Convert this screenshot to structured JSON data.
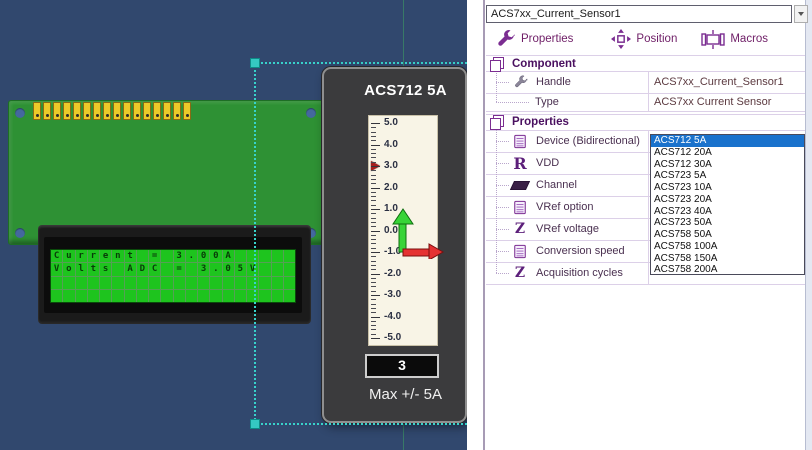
{
  "colors": {
    "canvas-bg": "#31486e",
    "grid-line": "#3a8266",
    "selection": "#38d2cb",
    "pcb": "#2e9134",
    "pin-gold": "#ecc929",
    "hole-blue": "#44689e",
    "lcd-green": "#1ec41e",
    "lcd-grid": "#55a055",
    "lcd-char": "#083c08",
    "panel-bg": "#3b3b3d",
    "scale-bg": "#f8f4e6",
    "marker-red": "#a51d1d",
    "arrow-green": "#38d438",
    "arrow-red": "#e53232",
    "accent-purple": "#7b2d91",
    "header-purple": "#4a1060",
    "label-purple": "#4a3050",
    "value-maroon": "#5c3a40",
    "list-selected": "#1a72cc"
  },
  "canvas": {
    "lcd": {
      "columns": 20,
      "rows": [
        "Current = 3.00A",
        "Volts ADC = 3.05V",
        "",
        ""
      ]
    },
    "gauge": {
      "title": "ACS712 5A",
      "value": "3",
      "max_label": "Max +/- 5A",
      "scale": {
        "min": -5,
        "max": 5,
        "minor_step": 0.2,
        "marker_value": 3,
        "labels": [
          "5.0",
          "4.0",
          "3.0",
          "2.0",
          "1.0",
          "0.0",
          "-1.0",
          "-2.0",
          "-3.0",
          "-4.0",
          "-5.0"
        ]
      }
    }
  },
  "properties_pane": {
    "combobox_value": "ACS7xx_Current_Sensor1",
    "toolbar": {
      "properties_label": "Properties",
      "position_label": "Position",
      "macros_label": "Macros"
    },
    "component": {
      "header": "Component",
      "rows": [
        {
          "icon": "wrench-icon",
          "label": "Handle",
          "value": "ACS7xx_Current_Sensor1"
        },
        {
          "icon": "none",
          "label": "Type",
          "value": "ACS7xx Current Sensor"
        }
      ]
    },
    "properties": {
      "header": "Properties",
      "rows": [
        {
          "icon": "list-icon",
          "label": "Device (Bidirectional)"
        },
        {
          "icon": "r-letter-icon",
          "icon_glyph": "R",
          "label": "VDD"
        },
        {
          "icon": "parallelogram-icon",
          "label": "Channel"
        },
        {
          "icon": "list-icon",
          "label": "VRef option"
        },
        {
          "icon": "z-letter-icon",
          "icon_glyph": "Z",
          "label": "VRef voltage"
        },
        {
          "icon": "list-icon",
          "label": "Conversion speed"
        },
        {
          "icon": "z-letter-icon",
          "icon_glyph": "Z",
          "label": "Acquisition cycles"
        }
      ]
    },
    "device_list": {
      "selected_index": 0,
      "items": [
        "ACS712 5A",
        "ACS712 20A",
        "ACS712 30A",
        "ACS723 5A",
        "ACS723 10A",
        "ACS723 20A",
        "ACS723 40A",
        "ACS723 50A",
        "ACS758 50A",
        "ACS758 100A",
        "ACS758 150A",
        "ACS758 200A"
      ]
    }
  }
}
